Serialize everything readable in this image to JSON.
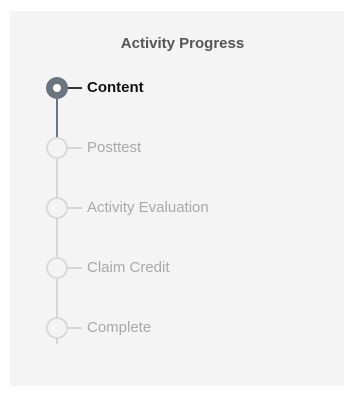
{
  "panel": {
    "title": "Activity Progress"
  },
  "steps": [
    {
      "label": "Content",
      "state": "current"
    },
    {
      "label": "Posttest",
      "state": "pending"
    },
    {
      "label": "Activity Evaluation",
      "state": "pending"
    },
    {
      "label": "Claim Credit",
      "state": "pending"
    },
    {
      "label": "Complete",
      "state": "pending"
    }
  ],
  "colors": {
    "current": "#6c7480",
    "pending": "#d9d9d9",
    "panel_bg": "#f4f4f4"
  }
}
